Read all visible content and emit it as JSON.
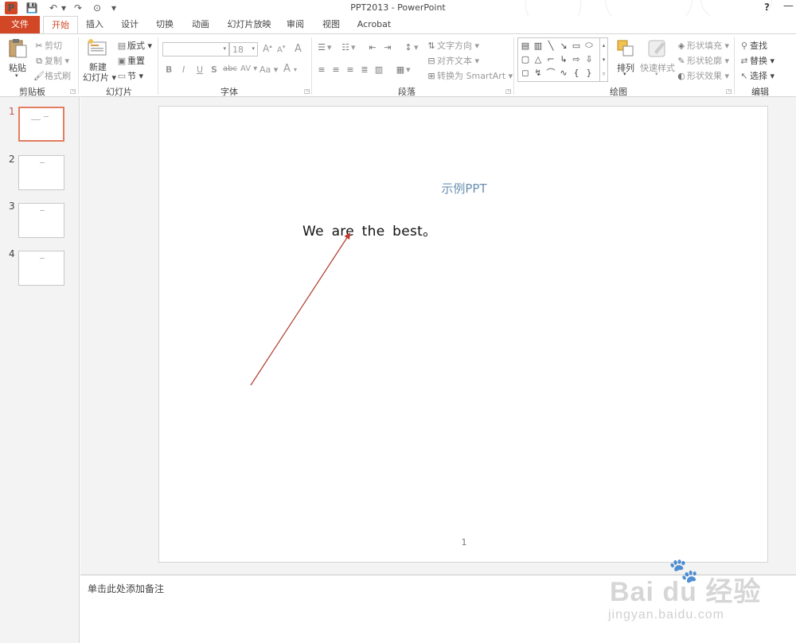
{
  "app": {
    "title": "PPT2013 - PowerPoint",
    "logo_letter": "P",
    "help": "?",
    "minimize": "—"
  },
  "qat": {
    "save_icon": "💾",
    "undo_icon": "↶",
    "redo_icon": "↷",
    "start_icon": "⊙",
    "dropdown": "▾"
  },
  "tabs": [
    {
      "label": "文件"
    },
    {
      "label": "开始"
    },
    {
      "label": "插入"
    },
    {
      "label": "设计"
    },
    {
      "label": "切换"
    },
    {
      "label": "动画"
    },
    {
      "label": "幻灯片放映"
    },
    {
      "label": "审阅"
    },
    {
      "label": "视图"
    },
    {
      "label": "Acrobat"
    }
  ],
  "ribbon": {
    "clipboard": {
      "label": "剪贴板",
      "paste": "粘贴",
      "cut": "剪切",
      "copy": "复制",
      "format_painter": "格式刷"
    },
    "slides": {
      "label": "幻灯片",
      "new_slide_line1": "新建",
      "new_slide_line2": "幻灯片",
      "layout": "版式",
      "reset": "重置",
      "section": "节"
    },
    "font": {
      "label": "字体",
      "font_size": "18",
      "bold": "B",
      "italic": "I",
      "underline": "U",
      "shadow": "S",
      "strike": "abc",
      "spacing": "AV",
      "case": "Aa",
      "color": "A",
      "grow": "A",
      "shrink": "A",
      "clear": "A"
    },
    "paragraph": {
      "label": "段落",
      "text_direction": "文字方向",
      "align_text": "对齐文本",
      "smartart": "转换为 SmartArt"
    },
    "drawing": {
      "label": "绘图",
      "arrange": "排列",
      "quick_styles": "快速样式",
      "shape_fill": "形状填充",
      "shape_outline": "形状轮廓",
      "shape_effects": "形状效果"
    },
    "editing": {
      "label": "编辑",
      "find": "查找",
      "replace": "替换",
      "select": "选择"
    }
  },
  "thumbnails": [
    {
      "number": "1",
      "selected": true
    },
    {
      "number": "2",
      "selected": false
    },
    {
      "number": "3",
      "selected": false
    },
    {
      "number": "4",
      "selected": false
    }
  ],
  "slide": {
    "title": "示例PPT",
    "body": "We are  the best。",
    "number": "1",
    "arrow_color": "#c0392b"
  },
  "notes": {
    "placeholder": "单击此处添加备注"
  },
  "watermark": {
    "brand": "Bai  du 经验",
    "paw": "🐾",
    "url": "jingyan.baidu.com"
  }
}
